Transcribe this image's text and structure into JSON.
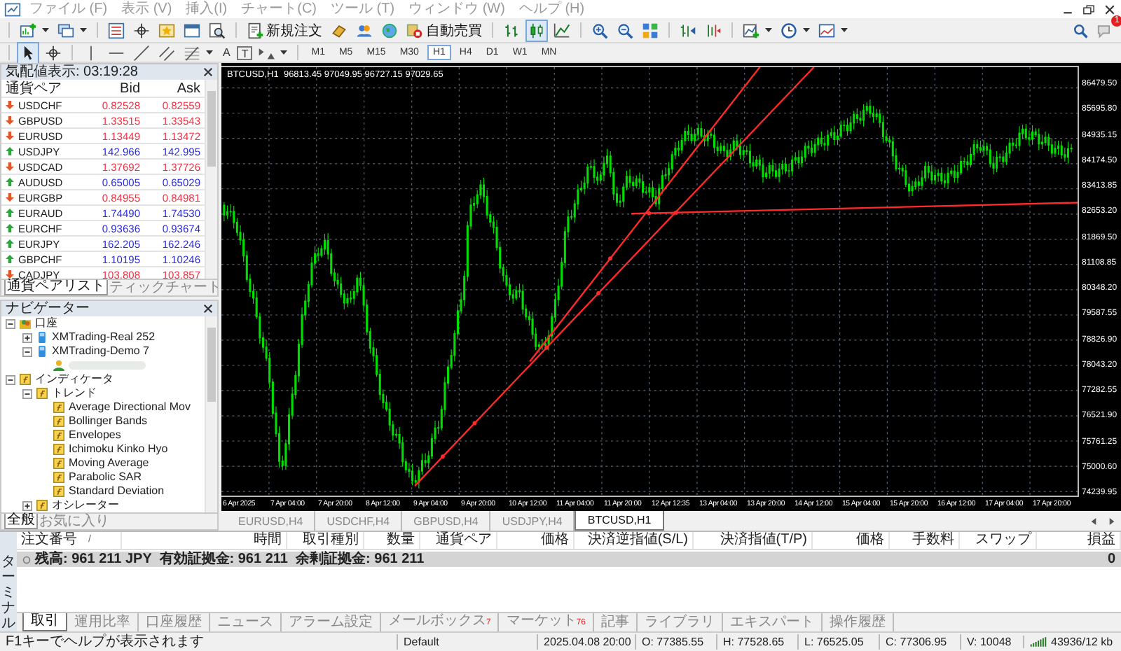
{
  "menu": [
    "ファイル (F)",
    "表示 (V)",
    "挿入(I)",
    "チャート(C)",
    "ツール (T)",
    "ウィンドウ (W)",
    "ヘルプ (H)"
  ],
  "toolbar": {
    "new_order": "新規注文",
    "auto_trading": "自動売買",
    "notification_count": "1",
    "chart_modes": [
      {
        "selected": false
      },
      {
        "selected": true
      },
      {
        "selected": false
      }
    ],
    "pointer_tools": [
      {
        "selected": true
      },
      {
        "selected": false
      }
    ],
    "text_tool": "A",
    "label_tool": "T",
    "timeframes": [
      {
        "label": "M1",
        "selected": false
      },
      {
        "label": "M5",
        "selected": false
      },
      {
        "label": "M15",
        "selected": false
      },
      {
        "label": "M30",
        "selected": false
      },
      {
        "label": "H1",
        "selected": true
      },
      {
        "label": "H4",
        "selected": false
      },
      {
        "label": "D1",
        "selected": false
      },
      {
        "label": "W1",
        "selected": false
      },
      {
        "label": "MN",
        "selected": false
      }
    ]
  },
  "market_watch": {
    "title": "気配値表示: 03:19:28",
    "columns": [
      "通貨ペア",
      "Bid",
      "Ask"
    ],
    "rows": [
      {
        "symbol": "USDCHF",
        "bid": "0.82528",
        "ask": "0.82559",
        "up": false
      },
      {
        "symbol": "GBPUSD",
        "bid": "1.33515",
        "ask": "1.33543",
        "up": false
      },
      {
        "symbol": "EURUSD",
        "bid": "1.13449",
        "ask": "1.13472",
        "up": false
      },
      {
        "symbol": "USDJPY",
        "bid": "142.966",
        "ask": "142.995",
        "up": true
      },
      {
        "symbol": "USDCAD",
        "bid": "1.37692",
        "ask": "1.37726",
        "up": false
      },
      {
        "symbol": "AUDUSD",
        "bid": "0.65005",
        "ask": "0.65029",
        "up": true
      },
      {
        "symbol": "EURGBP",
        "bid": "0.84955",
        "ask": "0.84981",
        "up": false
      },
      {
        "symbol": "EURAUD",
        "bid": "1.74490",
        "ask": "1.74530",
        "up": true
      },
      {
        "symbol": "EURCHF",
        "bid": "0.93636",
        "ask": "0.93674",
        "up": true
      },
      {
        "symbol": "EURJPY",
        "bid": "162.205",
        "ask": "162.246",
        "up": true
      },
      {
        "symbol": "GBPCHF",
        "bid": "1.10195",
        "ask": "1.10246",
        "up": true
      },
      {
        "symbol": "CADJPY",
        "bid": "103.808",
        "ask": "103.857",
        "up": false
      }
    ],
    "tabs": [
      {
        "label": "通貨ペアリスト",
        "selected": true
      },
      {
        "label": "ティックチャート",
        "selected": false
      }
    ]
  },
  "navigator": {
    "title": "ナビゲーター",
    "tree": [
      {
        "label": "口座",
        "kind": "accounts",
        "expanded": true,
        "children": [
          {
            "label": "XMTrading-Real 252",
            "kind": "server",
            "expanded": false
          },
          {
            "label": "XMTrading-Demo 7",
            "kind": "server",
            "expanded": true,
            "children": [
              {
                "kind": "user"
              }
            ]
          }
        ]
      },
      {
        "label": "インディケータ",
        "kind": "indicator",
        "expanded": true,
        "children": [
          {
            "label": "トレンド",
            "kind": "indicator",
            "expanded": true,
            "children": [
              {
                "label": "Average Directional Mov",
                "kind": "indicator"
              },
              {
                "label": "Bollinger Bands",
                "kind": "indicator"
              },
              {
                "label": "Envelopes",
                "kind": "indicator"
              },
              {
                "label": "Ichimoku Kinko Hyo",
                "kind": "indicator"
              },
              {
                "label": "Moving Average",
                "kind": "indicator"
              },
              {
                "label": "Parabolic SAR",
                "kind": "indicator"
              },
              {
                "label": "Standard Deviation",
                "kind": "indicator"
              }
            ]
          },
          {
            "label": "オシレーター",
            "kind": "indicator",
            "expanded": false
          }
        ]
      }
    ],
    "tabs": [
      {
        "label": "全般",
        "selected": true
      },
      {
        "label": "お気に入り",
        "selected": false
      }
    ]
  },
  "chart": {
    "title": "BTCUSD,H1  96813.45 97049.95 96727.15 97029.65",
    "price_axis": [
      "86479.50",
      "85695.80",
      "84935.15",
      "84174.50",
      "83413.85",
      "82653.20",
      "81869.50",
      "81108.85",
      "80348.20",
      "79587.55",
      "78826.90",
      "78043.20",
      "77282.55",
      "76521.90",
      "75761.25",
      "75000.60",
      "74239.95"
    ],
    "time_axis": [
      "6 Apr 2025",
      "7 Apr 04:00",
      "7 Apr 20:00",
      "8 Apr 12:00",
      "9 Apr 04:00",
      "9 Apr 20:00",
      "10 Apr 12:00",
      "11 Apr 04:00",
      "11 Apr 20:00",
      "12 Apr 12:35",
      "13 Apr 04:00",
      "13 Apr 20:00",
      "14 Apr 12:00",
      "15 Apr 04:00",
      "15 Apr 20:00",
      "16 Apr 12:00",
      "17 Apr 04:00",
      "17 Apr 20:00"
    ],
    "tabs": [
      {
        "label": "EURUSD,H4",
        "selected": false
      },
      {
        "label": "USDCHF,H4",
        "selected": false
      },
      {
        "label": "GBPUSD,H4",
        "selected": false
      },
      {
        "label": "USDJPY,H4",
        "selected": false
      },
      {
        "label": "BTCUSD,H1",
        "selected": true
      }
    ]
  },
  "terminal": {
    "label": "ターミナル",
    "sort_mark": "/",
    "columns": [
      "注文番号",
      "時間",
      "取引種別",
      "数量",
      "通貨ペア",
      "価格",
      "決済逆指値(S/L)",
      "決済指値(T/P)",
      "価格",
      "手数料",
      "スワップ",
      "損益"
    ],
    "balance": "残高: 961 211 JPY  有効証拠金: 961 211  余剰証拠金: 961 211",
    "profit": "0",
    "tabs": [
      {
        "label": "取引",
        "selected": true
      },
      {
        "label": "運用比率",
        "selected": false
      },
      {
        "label": "口座履歴",
        "selected": false
      },
      {
        "label": "ニュース",
        "selected": false
      },
      {
        "label": "アラーム設定",
        "selected": false
      },
      {
        "label": "メールボックス",
        "badge": "7",
        "selected": false
      },
      {
        "label": "マーケット",
        "badge": "76",
        "selected": false
      },
      {
        "label": "記事",
        "selected": false
      },
      {
        "label": "ライブラリ",
        "selected": false
      },
      {
        "label": "エキスパート",
        "selected": false
      },
      {
        "label": "操作履歴",
        "selected": false
      }
    ]
  },
  "status_bar": {
    "help": "F1キーでヘルプが表示されます",
    "profile": "Default",
    "time": "2025.04.08 20:00",
    "open": "O: 77385.55",
    "high": "H: 77528.65",
    "low": "L: 76525.05",
    "close": "C: 77306.95",
    "volume": "V: 10048",
    "traffic": "43936/12 kb"
  }
}
